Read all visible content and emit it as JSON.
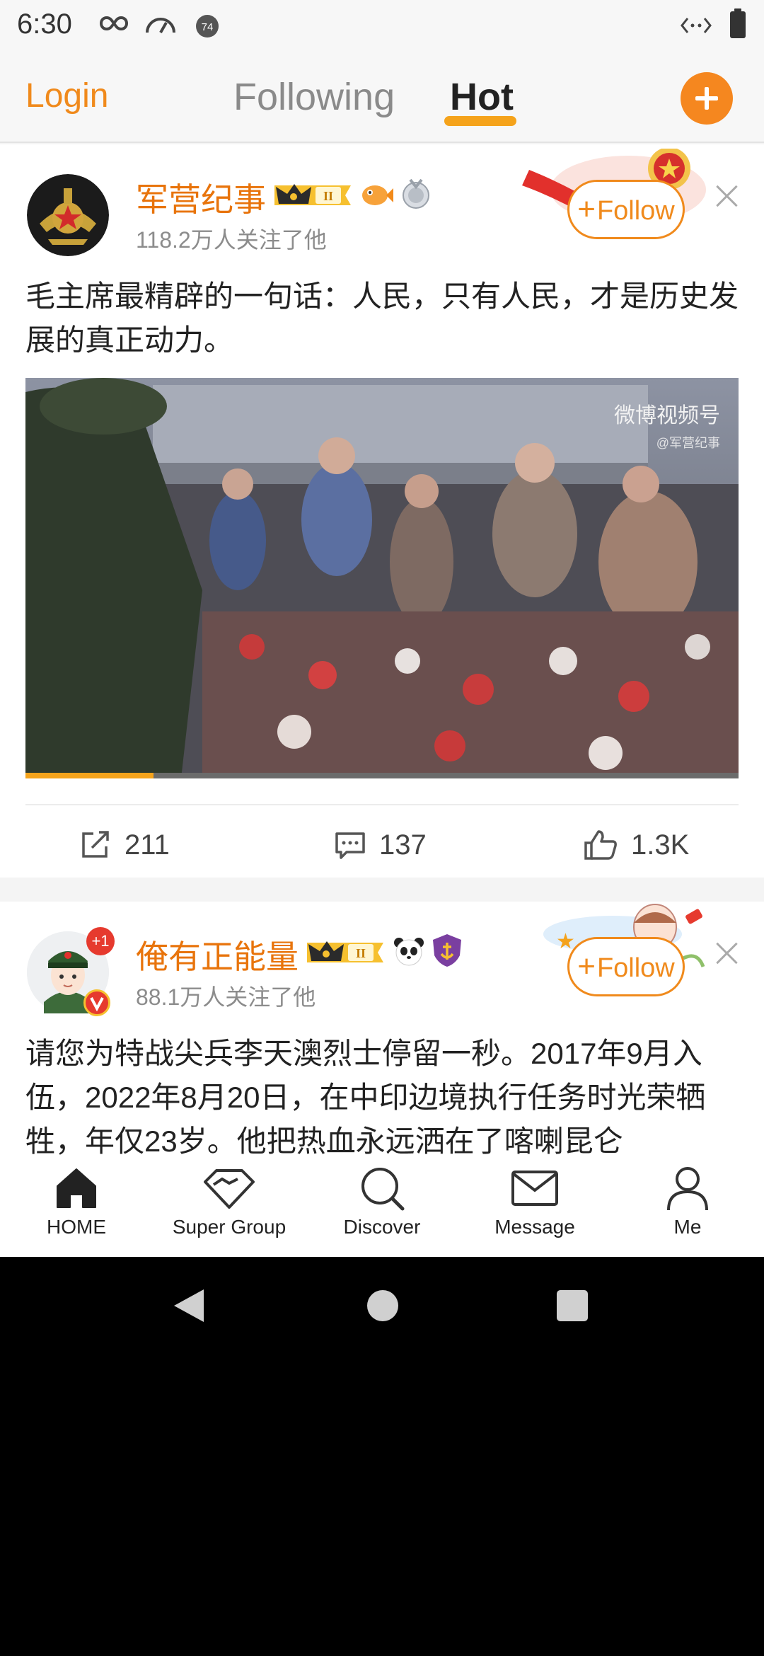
{
  "status_bar": {
    "time": "6:30",
    "icons": [
      "infinity-icon",
      "speedometer-icon",
      "notification-74-icon",
      "data-arrows-icon",
      "battery-icon"
    ],
    "notification_count": "74"
  },
  "top_nav": {
    "login_label": "Login",
    "tabs": [
      {
        "label": "Following",
        "active": false
      },
      {
        "label": "Hot",
        "active": true
      }
    ],
    "accent_color": "#f5871f"
  },
  "posts": [
    {
      "username": "军营纪事",
      "level_badge": "II",
      "followers": "118.2万人关注了他",
      "follow_label": "Follow",
      "text": "毛主席最精辟的一句话：人民，只有人民，才是历史发展的真正动力。",
      "video": {
        "watermark": "微博视频号",
        "watermark_sub": "@军营纪事",
        "progress": 0.18
      },
      "actions": {
        "shares": "211",
        "comments": "137",
        "likes": "1.3K"
      }
    },
    {
      "username": "俺有正能量",
      "level_badge": "II",
      "avatar_badge": "+1",
      "followers": "88.1万人关注了他",
      "follow_label": "Follow",
      "text": "请您为特战尖兵李天澳烈士停留一秒。2017年9月入伍，2022年8月20日，在中印边境执行任务时光荣牺牲，年仅23岁。他把热血永远洒在了喀喇昆仑"
    }
  ],
  "bottom_nav": [
    {
      "label": "HOME",
      "icon": "home-icon"
    },
    {
      "label": "Super Group",
      "icon": "diamond-icon"
    },
    {
      "label": "Discover",
      "icon": "search-icon"
    },
    {
      "label": "Message",
      "icon": "mail-icon"
    },
    {
      "label": "Me",
      "icon": "person-icon"
    }
  ]
}
